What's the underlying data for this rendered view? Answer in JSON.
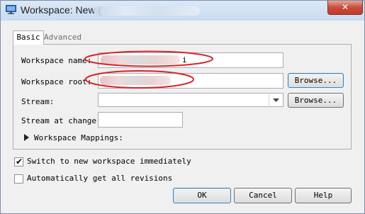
{
  "window": {
    "title": "Workspace: New (",
    "close_glyph": "✕"
  },
  "tabs": [
    {
      "label": "Basic",
      "active": true
    },
    {
      "label": "Advanced",
      "active": false
    }
  ],
  "form": {
    "workspace_name_label": "Workspace name:",
    "workspace_name_value": "i",
    "workspace_root_label": "Workspace root:",
    "workspace_root_value": "",
    "browse_label": "Browse...",
    "stream_label": "Stream:",
    "stream_value": "",
    "stream_browse_label": "Browse...",
    "stream_at_change_label": "Stream at change:",
    "stream_at_change_value": "",
    "mappings_label": "Workspace Mappings:"
  },
  "options": {
    "switch_label": "Switch to new workspace immediately",
    "switch_checked": true,
    "auto_get_label": "Automatically get all revisions",
    "auto_get_checked": false
  },
  "footer": {
    "ok_label": "OK",
    "cancel_label": "Cancel",
    "help_label": "Help"
  },
  "colors": {
    "annotation_red": "#d9232a",
    "close_button": "#c94d3b"
  },
  "icons": {
    "title_icon": "monitor-icon",
    "close": "close-icon",
    "expander": "triangle-right-icon",
    "dropdown": "chevron-down-icon"
  }
}
